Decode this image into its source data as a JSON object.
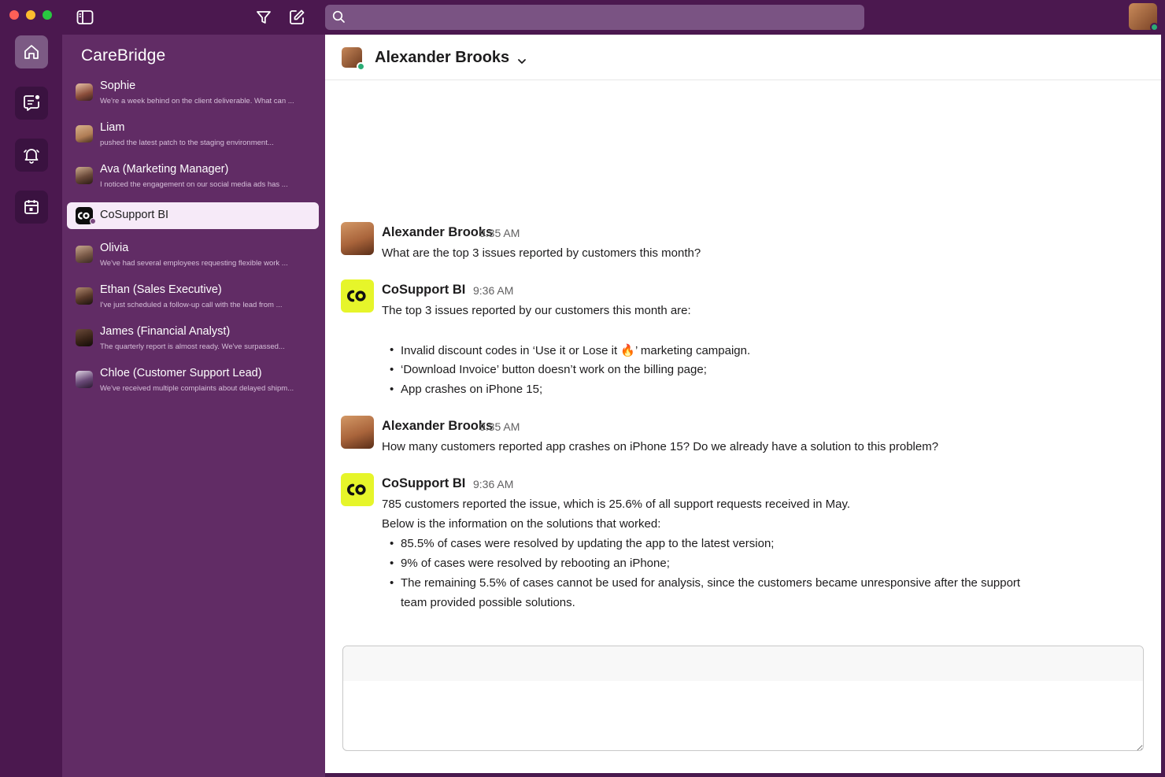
{
  "app": {
    "workspace_name": "CareBridge",
    "search_placeholder": ""
  },
  "colors": {
    "sidebar_bg": "#612c65",
    "titlebar_bg": "#4b184f",
    "bot_accent": "#e6f52a",
    "online": "#2bac76"
  },
  "rail": {
    "items": [
      {
        "name": "home-icon",
        "active": true
      },
      {
        "name": "messages-icon",
        "active": false
      },
      {
        "name": "notifications-icon",
        "active": false
      },
      {
        "name": "calendar-icon",
        "active": false
      }
    ]
  },
  "conversations": [
    {
      "name": "Sophie",
      "preview": "We're a week behind on the client deliverable. What can ..."
    },
    {
      "name": "Liam",
      "preview": "pushed the latest patch to the staging environment..."
    },
    {
      "name": "Ava (Marketing Manager)",
      "preview": "I noticed the engagement on our social media ads has ..."
    },
    {
      "name": "CoSupport BI",
      "preview": "",
      "active": true
    },
    {
      "name": "Olivia",
      "preview": "We've had several employees requesting flexible work ..."
    },
    {
      "name": "Ethan (Sales Executive)",
      "preview": "I've just scheduled a follow-up call with the lead from ..."
    },
    {
      "name": "James (Financial Analyst)",
      "preview": "The quarterly report is almost ready. We've surpassed..."
    },
    {
      "name": "Chloe (Customer Support Lead)",
      "preview": "We've received multiple complaints about delayed shipm..."
    }
  ],
  "channel": {
    "title": "Alexander Brooks"
  },
  "messages": [
    {
      "author": "Alexander Brooks",
      "time": "9:35 AM",
      "lines": [
        "What are the top 3 issues reported by customers this month?"
      ]
    },
    {
      "author": "CoSupport BI",
      "time": "9:36 AM",
      "lines": [
        "The top 3 issues reported by our customers this month are:"
      ],
      "bullets": [
        "Invalid discount codes in ‘Use it or Lose it 🔥’ marketing campaign.",
        "‘Download Invoice’ button doesn’t work on the billing page;",
        "App crashes on iPhone 15;"
      ]
    },
    {
      "author": "Alexander Brooks",
      "time": "9:35 AM",
      "lines": [
        "How many customers reported app crashes on iPhone 15? Do we already have a solution to this problem?"
      ]
    },
    {
      "author": "CoSupport BI",
      "time": "9:36 AM",
      "lines": [
        "785 customers reported the issue, which is 25.6% of all support requests received in May.",
        "Below is the information on the solutions that worked:"
      ],
      "bullets": [
        "85.5% of cases were resolved by updating the app to the latest version;",
        "9% of cases were resolved by rebooting an iPhone;",
        "The remaining 5.5% of cases cannot be used for analysis, since the customers became unresponsive after the support",
        "team provided possible solutions."
      ]
    }
  ],
  "composer": {
    "placeholder": ""
  }
}
